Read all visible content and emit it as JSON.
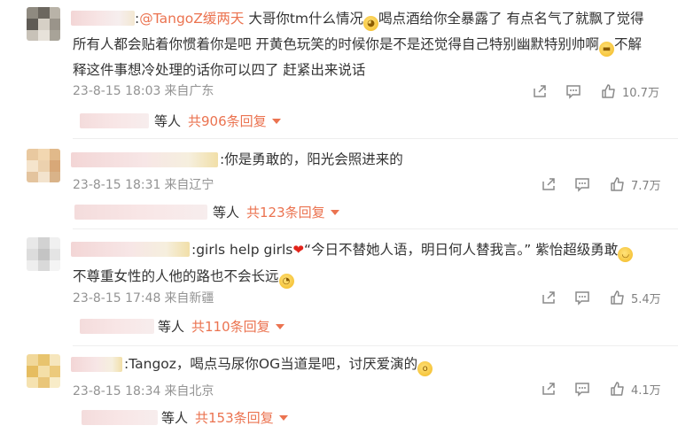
{
  "comments": [
    {
      "mention": "@TangoZ缓两天",
      "text_line1": "大哥你tm什么情况",
      "text_line1b": "喝点酒给你全暴露了 有点名气了就飘了觉得",
      "text_line2": "所有人都会贴着你惯着你是吧 开黄色玩笑的时候你是不是还觉得自己特别幽默特别帅啊",
      "text_line2b": "不解",
      "text_line3": "释这件事想冷处理的话你可以四了 赶紧出来说话",
      "time": "23-8-15 18:03",
      "location": "来自广东",
      "likes": "10.7万",
      "reply_suffix": "等人",
      "reply_count": "共906条回复"
    },
    {
      "text_line1": ":你是勇敢的，阳光会照进来的",
      "time": "23-8-15 18:31",
      "location": "来自辽宁",
      "likes": "7.7万",
      "reply_suffix": "等人",
      "reply_count": "共123条回复"
    },
    {
      "text_line1a": ":girls help girls",
      "text_line1b": "“今日不替她人语，明日何人替我言。” 紫怡超级勇敢",
      "text_line2": "不尊重女性的人他的路也不会长远",
      "time": "23-8-15 17:48",
      "location": "来自新疆",
      "likes": "5.4万",
      "reply_suffix": "等人",
      "reply_count": "共110条回复"
    },
    {
      "text_line1": ":Tangoz，喝点马尿你OG当道是吧，讨厌爱演的",
      "time": "23-8-15 18:34",
      "location": "来自北京",
      "likes": "4.1万",
      "reply_suffix": "等人",
      "reply_count": "共153条回复"
    }
  ],
  "colors": {
    "accent": "#eb7350",
    "meta": "#939393",
    "text": "#333333"
  }
}
